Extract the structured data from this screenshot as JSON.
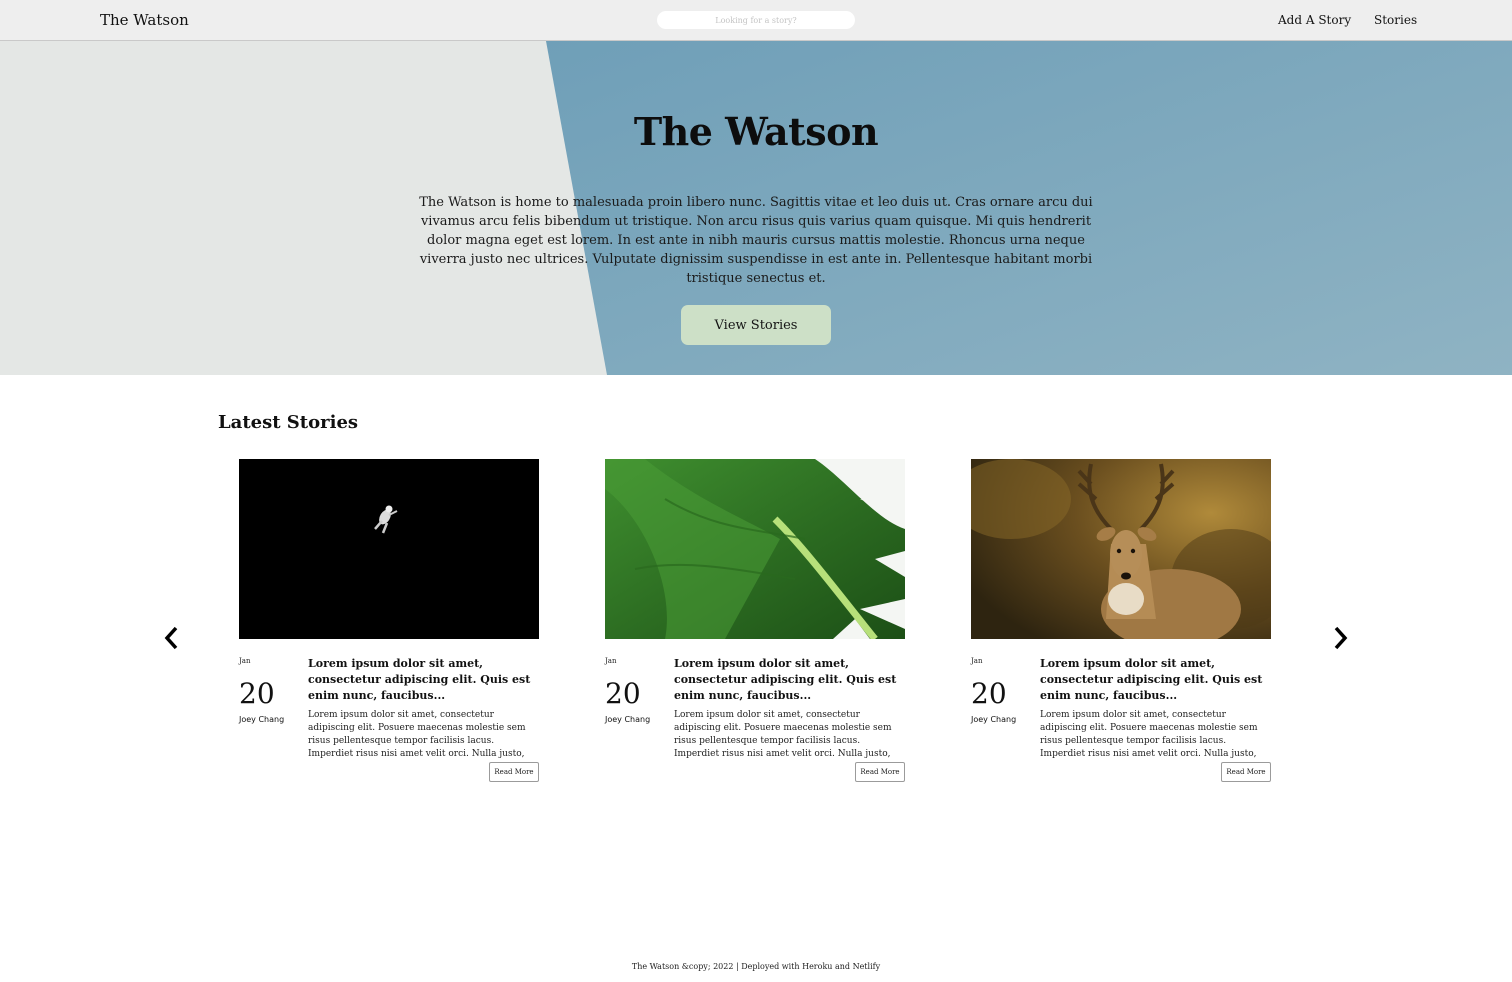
{
  "nav": {
    "brand": "The Watson",
    "search_placeholder": "Looking for a story?",
    "links": [
      "Add A Story",
      "Stories"
    ]
  },
  "hero": {
    "title": "The Watson",
    "text": "The Watson is home to malesuada proin libero nunc. Sagittis vitae et leo duis ut. Cras ornare arcu dui vivamus arcu felis bibendum ut tristique. Non arcu risus quis varius quam quisque. Mi quis hendrerit dolor magna eget est lorem. In est ante in nibh mauris cursus mattis molestie. Rhoncus urna neque viverra justo nec ultrices. Vulputate dignissim suspendisse in est ante in. Pellentesque habitant morbi tristique senectus et.",
    "button": "View Stories",
    "colors": {
      "left": "#e4e7e5",
      "right": "#7fa9bf",
      "button": "#cde0c7"
    }
  },
  "stories": {
    "title": "Latest Stories",
    "prev_icon": "chevron-left-icon",
    "next_icon": "chevron-right-icon",
    "cards": [
      {
        "image": "astronaut-over-earth",
        "month": "Jan",
        "day": "20",
        "author": "Joey Chang",
        "heading": "Lorem ipsum dolor sit amet, consectetur adipiscing elit. Quis est enim nunc, faucibus...",
        "body": "Lorem ipsum dolor sit amet, consectetur adipiscing elit. Posuere maecenas molestie sem risus pellentesque tempor facilisis lacus. Imperdiet risus nisi amet velit orci. Nulla justo,",
        "button": "Read More"
      },
      {
        "image": "monstera-leaf",
        "month": "Jan",
        "day": "20",
        "author": "Joey Chang",
        "heading": "Lorem ipsum dolor sit amet, consectetur adipiscing elit. Quis est enim nunc, faucibus...",
        "body": "Lorem ipsum dolor sit amet, consectetur adipiscing elit. Posuere maecenas molestie sem risus pellentesque tempor facilisis lacus. Imperdiet risus nisi amet velit orci. Nulla justo,",
        "button": "Read More"
      },
      {
        "image": "deer-in-forest",
        "month": "Jan",
        "day": "20",
        "author": "Joey Chang",
        "heading": "Lorem ipsum dolor sit amet, consectetur adipiscing elit. Quis est enim nunc, faucibus...",
        "body": "Lorem ipsum dolor sit amet, consectetur adipiscing elit. Posuere maecenas molestie sem risus pellentesque tempor facilisis lacus. Imperdiet risus nisi amet velit orci. Nulla justo,",
        "button": "Read More"
      }
    ]
  },
  "footer": {
    "text": "The Watson &copy; 2022 | Deployed with Heroku and Netlify"
  }
}
